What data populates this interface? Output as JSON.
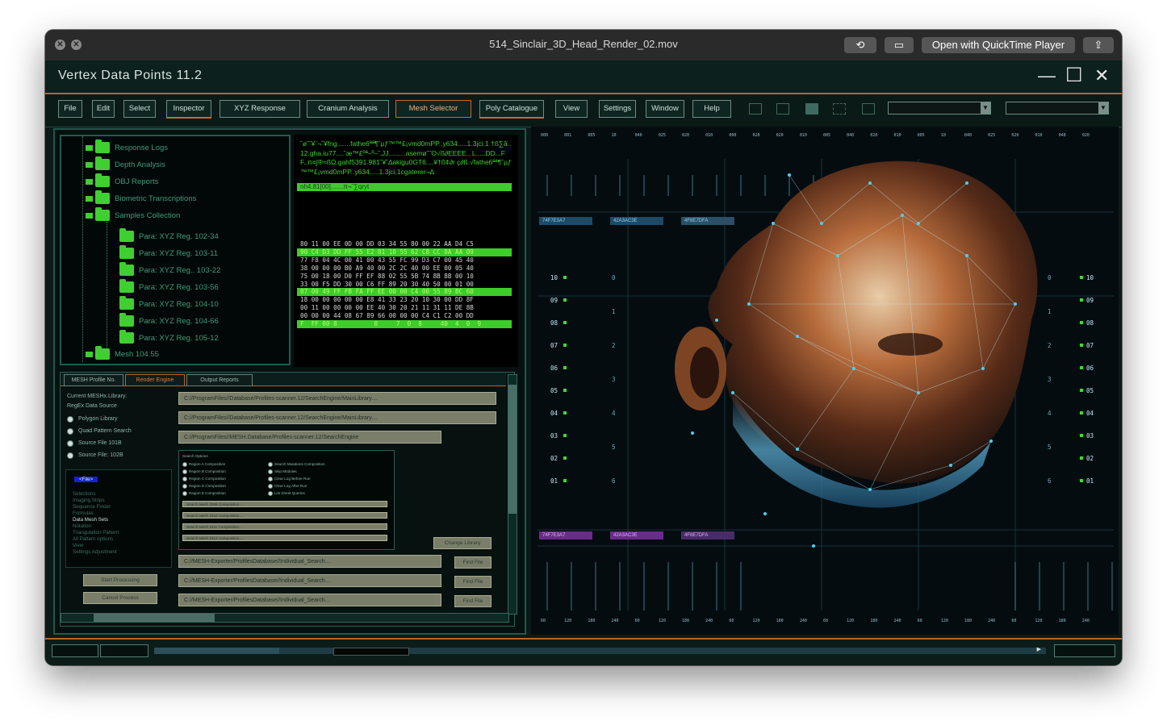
{
  "player": {
    "title": "514_Sinclair_3D_Head_Render_02.mov",
    "open_with_label": "Open with QuickTime Player"
  },
  "app": {
    "title": "Vertex Data Points 11.2",
    "minimize_glyph": "—",
    "maximize_glyph": "☐",
    "close_glyph": "✕"
  },
  "menu": [
    {
      "label": "File"
    },
    {
      "label": "Edit"
    },
    {
      "label": "Select"
    },
    {
      "label": "Inspector"
    },
    {
      "label": "XYZ Response"
    },
    {
      "label": "Cranium Analysis"
    },
    {
      "label": "Mesh Selector"
    },
    {
      "label": "Poly Catalogue"
    },
    {
      "label": "View"
    },
    {
      "label": "Settings"
    },
    {
      "label": "Window"
    },
    {
      "label": "Help"
    }
  ],
  "tree": {
    "items": [
      "Response Logs",
      "Depth Analysis",
      "OBJ Reports",
      "Biometric Transcriptions",
      "Samples Collection",
      "Para: XYZ Reg. 102-34",
      "Para: XYZ Reg. 103-11",
      "Para: XYZ Reg.. 103-22",
      "Para: XYZ Reg. 103-56",
      "Para: XYZ Reg. 104-10",
      "Para: XYZ Reg. 104-66",
      "Para: XYZ Reg. 105-12",
      "Mesh 104.55"
    ]
  },
  "hex": {
    "garbled": "˘ø˘˘¥¨¬˘¥fng.......fathe6ªª¶˘µƒ™™£¡vmd0mPP..y634.....1.3jci.1 †ß∑â..12.gha.iu77....˘æ™£ºª–º–˘‚JJ.........asemø˘˜ʘ√ß∂EEEE.. L.....DD...FF..π¤∫®≈ßΩ.gahf5391.981˘¥˘∆akigu0GT6....¥†ß¢∂r ç∂ß.√fathe6ªª¶˘µƒ™™£¡vmd0mPP..y634.....1.3jci.1cgaterer¬∆",
    "highlight": "nh4.81[00].......π¬˘∑qryt",
    "rows": [
      "80 11 00 EE 0D 00 DD 03 34 55 80 00 22 AA D4 C5",
      "90 C4 D3 DD FF 55 E2 01 10 55 62 C8 CC 0A AA 09",
      "77 F8 04 4C 00 41 00 43 55 FC 99 D3 C7 00 45 40",
      "38 00 00 00 B0 A9 40 00 2C 2C 40 00 EE 00 05 40",
      "75 00 18 00 D0 FF EF 88 02 55 5B 74 8B 8B 00 10",
      "33 00 F5 DD 30 00 C6 FF 89 20 30 40 50 00 01 00",
      "07 00 49 FF FB FA FF EE 00 00 C4 00 55 89 BC 60",
      "18 00 00 00 00 00 E8 41 33 23 20 10 30 00 DD 8F",
      "00 11 00 00 00 00 EE 40 30 20 21 11 31 11 DE 8B",
      "00 00 00 44 08 67 89 66 00 00 00 C4 C1 C2 00 DD",
      "F  FF 00 8          0     7  0  8     40  4  0  9"
    ]
  },
  "tabs": [
    "MESH Profile No.",
    "Render Engine",
    "Output Reports"
  ],
  "config": {
    "library_label": "Current MESHx.Library:",
    "regex_label": "RegEx Data Source",
    "radios": [
      "Polygon Library",
      "Quad Pattern Search",
      "Source File 101B",
      "Source File: 102B"
    ],
    "paths": [
      "C://ProgramFiles//Database/Profiles-scanner.12/SearchEngine/MainLibrary....",
      "C://ProgramFiles//Database/Profiles-scanner.12/SearchEngine/MainLibrary....",
      "C://ProgramFiles//MESH.Database/Profiles-scanner.12/SearchEngine"
    ],
    "change_library": "Change Library",
    "export_paths": [
      "C://MESH-Exporter/ProfilesDatabase//Individual_Search....",
      "C://MESH-Exporter/ProfilesDatabase//Individual_Search....",
      "C://MESH-Exporter/ProfilesDatabase//Individual_Search...."
    ],
    "find_file": "Find File",
    "start_processing": "Start Processing",
    "cancel_process": "Cancel Process"
  },
  "search_options": {
    "title": "Search Options",
    "left": [
      "Region A Composition",
      "Region B Composition",
      "Region C Composition",
      "Region D Composition",
      "Region E Composition"
    ],
    "right": [
      "Search Mutations Composition",
      "Skip Modules",
      "Clear Log Before Run",
      "Clear Log After Run",
      "List Sheet Queries"
    ],
    "meshes": [
      "Search Mesh 2309 Composition....",
      "Search Mesh 2310 Composition....",
      "Search Mesh 2311 Composition....",
      "Search Mesh 2312 Composition...."
    ]
  },
  "side_list": {
    "selected": "<File>",
    "items": [
      "Selections",
      "Imaging Strips",
      "Sequence Finder",
      "Formulas",
      "Data Mesh Sets",
      "Notation",
      "Triangulation Pattern",
      "All Pattern options",
      "View",
      "Settings Adjustment"
    ]
  },
  "hud": {
    "tags_top": [
      "74F7E3A7",
      "42A3AC3E",
      "4F8E7DFA"
    ],
    "tags_bottom": [
      "74F7E3A7",
      "42A3AC3E",
      "4F8E7DFA"
    ],
    "scale_left": [
      "10",
      "09",
      "08",
      "07",
      "06",
      "05",
      "04",
      "03",
      "02",
      "01"
    ],
    "scale_right": [
      "10",
      "09",
      "08",
      "07",
      "06",
      "05",
      "04",
      "03",
      "02",
      "01"
    ],
    "inner_left": [
      "0",
      "1",
      "2",
      "3",
      "4",
      "5",
      "6"
    ],
    "top_ticks": [
      "000",
      "001",
      "005",
      "10",
      "040",
      "025",
      "020",
      "010",
      "000",
      "028",
      "020",
      "010",
      "005",
      "040",
      "020",
      "010",
      "005",
      "10",
      "040",
      "025",
      "020",
      "010",
      "048",
      "020"
    ],
    "bottom_ticks": [
      "60",
      "120",
      "180",
      "240",
      "60",
      "120",
      "180",
      "240",
      "60",
      "120",
      "180",
      "240",
      "60",
      "120",
      "180",
      "240",
      "60",
      "120",
      "180",
      "240",
      "60",
      "120",
      "180",
      "240"
    ],
    "colors": {
      "grid": "#2f7a8a",
      "accent": "#4ad0f0",
      "green": "#35e02a",
      "purple": "#6a2b8a"
    }
  }
}
